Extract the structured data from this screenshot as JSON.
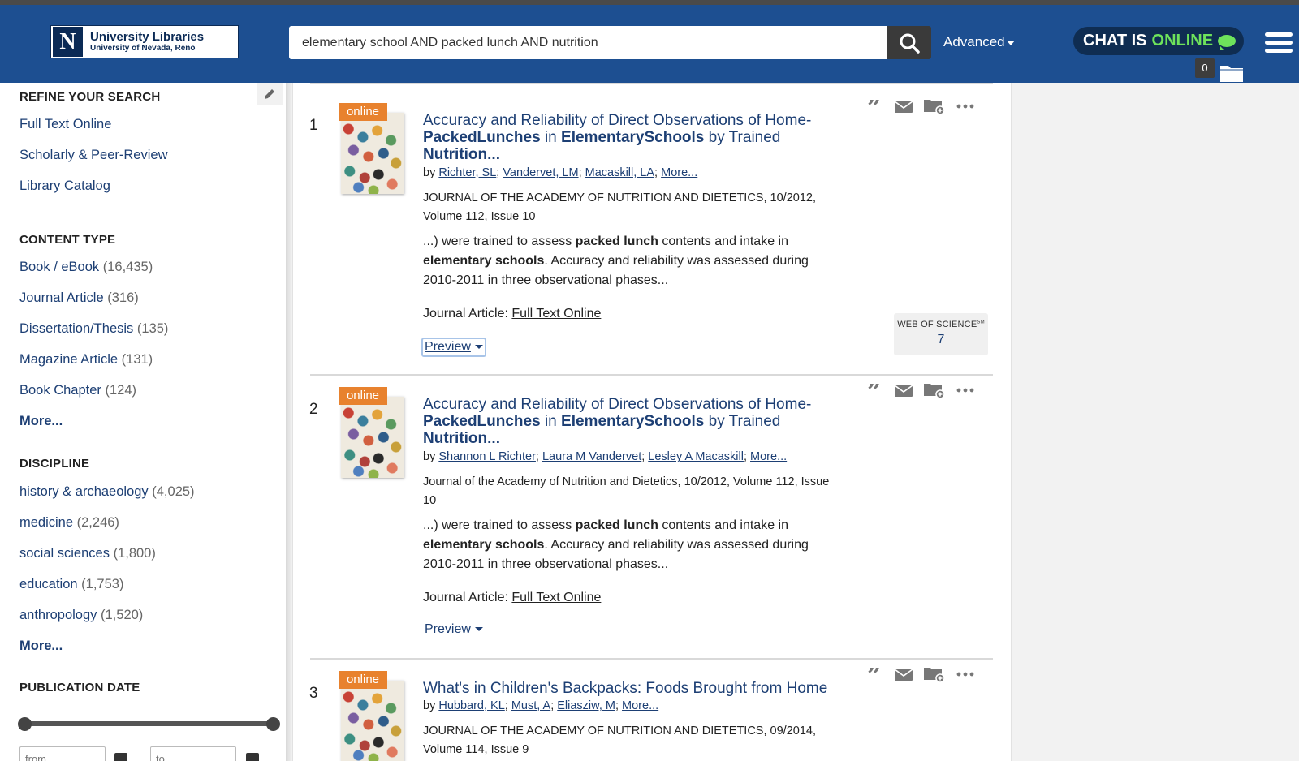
{
  "header": {
    "logo_letter": "N",
    "logo_title": "University Libraries",
    "logo_subtitle": "University of Nevada, Reno",
    "search_value": "elementary school AND packed lunch AND nutrition",
    "advanced_label": "Advanced",
    "chat_prefix": "CHAT IS",
    "chat_status": "ONLINE",
    "folder_count": "0"
  },
  "sidebar": {
    "refine_heading": "REFINE YOUR SEARCH",
    "refine_links": [
      "Full Text Online",
      "Scholarly & Peer-Review",
      "Library Catalog"
    ],
    "content_type_heading": "CONTENT TYPE",
    "content_types": [
      {
        "label": "Book / eBook",
        "count": "(16,435)"
      },
      {
        "label": "Journal Article",
        "count": "(316)"
      },
      {
        "label": "Dissertation/Thesis",
        "count": "(135)"
      },
      {
        "label": "Magazine Article",
        "count": "(131)"
      },
      {
        "label": "Book Chapter",
        "count": "(124)"
      }
    ],
    "content_type_more": "More...",
    "discipline_heading": "DISCIPLINE",
    "disciplines": [
      {
        "label": "history & archaeology",
        "count": "(4,025)"
      },
      {
        "label": "medicine",
        "count": "(2,246)"
      },
      {
        "label": "social sciences",
        "count": "(1,800)"
      },
      {
        "label": "education",
        "count": "(1,753)"
      },
      {
        "label": "anthropology",
        "count": "(1,520)"
      }
    ],
    "discipline_more": "More...",
    "pubdate_heading": "PUBLICATION DATE",
    "from_placeholder": "from",
    "to_placeholder": "to"
  },
  "results": [
    {
      "number": "1",
      "badge": "online",
      "title_parts": [
        "Accuracy and Reliability of Direct Observations of Home-",
        "PackedLunches",
        " in ",
        "ElementarySchools",
        " by Trained ",
        "Nutrition..."
      ],
      "by": "by ",
      "authors": [
        "Richter, SL",
        "Vandervet, LM",
        "Macaskill, LA",
        "More..."
      ],
      "source": "JOURNAL OF THE ACADEMY OF NUTRITION AND DIETETICS, 10/2012, Volume 112, Issue 10",
      "snippet_parts": [
        "...) were trained to assess ",
        "packed lunch",
        " contents and intake in ",
        "elementary schools",
        ". Accuracy and reliability was assessed during 2010-2011 in three observational phases..."
      ],
      "type_label": "Journal Article: ",
      "type_link": "Full Text Online",
      "preview": "Preview",
      "wos_label": "WEB OF SCIENCE",
      "wos_sup": "SM",
      "wos_count": "7"
    },
    {
      "number": "2",
      "badge": "online",
      "title_parts": [
        "Accuracy and Reliability of Direct Observations of Home-",
        "PackedLunches",
        " in ",
        "ElementarySchools",
        " by Trained ",
        "Nutrition..."
      ],
      "by": "by ",
      "authors": [
        "Shannon L Richter",
        "Laura M Vandervet",
        "Lesley A Macaskill",
        "More..."
      ],
      "source": "Journal of the Academy of Nutrition and Dietetics, 10/2012, Volume 112, Issue 10",
      "snippet_parts": [
        "...) were trained to assess ",
        "packed lunch",
        " contents and intake in ",
        "elementary schools",
        ". Accuracy and reliability was assessed during 2010-2011 in three observational phases..."
      ],
      "type_label": "Journal Article: ",
      "type_link": "Full Text Online",
      "preview": "Preview"
    },
    {
      "number": "3",
      "badge": "online",
      "title": "What's in Children's Backpacks: Foods Brought from Home",
      "by": "by ",
      "authors": [
        "Hubbard, KL",
        "Must, A",
        "Eliasziw, M",
        "More..."
      ],
      "source": "JOURNAL OF THE ACADEMY OF NUTRITION AND DIETETICS, 09/2014, Volume 114, Issue 9"
    }
  ],
  "colors": {
    "header_blue": "#1d4f91",
    "link_blue": "#1d3f74",
    "online_orange": "#e8822e",
    "chat_green": "#6ee35b"
  },
  "icons": [
    "search-icon",
    "quote-icon",
    "email-icon",
    "folder-add-icon",
    "more-icon",
    "folder-icon",
    "pencil-icon",
    "calendar-icon",
    "menu-icon"
  ]
}
